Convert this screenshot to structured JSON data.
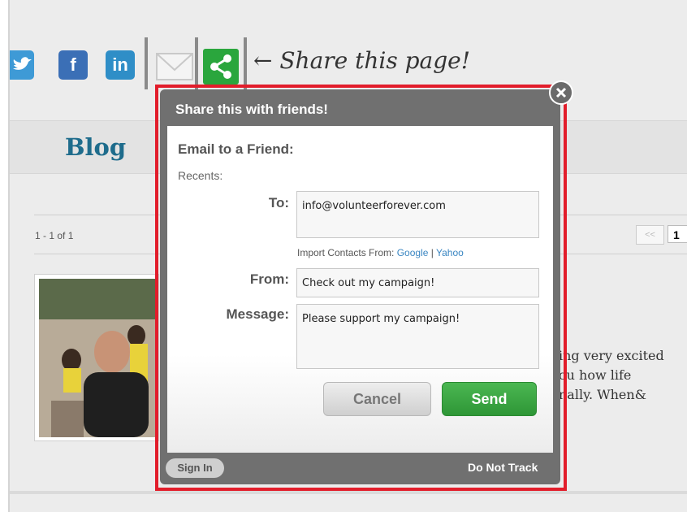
{
  "social": {
    "twitter_icon": "twitter-icon",
    "facebook_label": "f",
    "linkedin_label": "in",
    "mail_icon": "mail-icon",
    "share_icon": "share-icon",
    "share_text": "← Share this page!"
  },
  "page": {
    "section_title": "Blog",
    "result_count": "1 - 1 of 1",
    "pager_prev": "<<",
    "pager_current": "1",
    "excerpt_lines": [
      "ing very excited",
      "ou how life",
      "nally.  When&"
    ]
  },
  "modal": {
    "title": "Share this with friends!",
    "section_title": "Email to a Friend:",
    "recents_label": "Recents:",
    "to_label": "To:",
    "to_value": "info@volunteerforever.com",
    "import_label": "Import Contacts From:",
    "import_google": "Google",
    "import_sep": "|",
    "import_yahoo": "Yahoo",
    "from_label": "From:",
    "from_value": "Check out my campaign!",
    "message_label": "Message:",
    "message_value": "Please support my campaign!",
    "cancel_label": "Cancel",
    "send_label": "Send",
    "signin_label": "Sign In",
    "do_not_track_label": "Do Not Track"
  },
  "colors": {
    "highlight_border": "#e21d2b",
    "send_button": "#2e9636",
    "blog_title": "#1e6c8c",
    "share_green": "#2aa63d"
  }
}
